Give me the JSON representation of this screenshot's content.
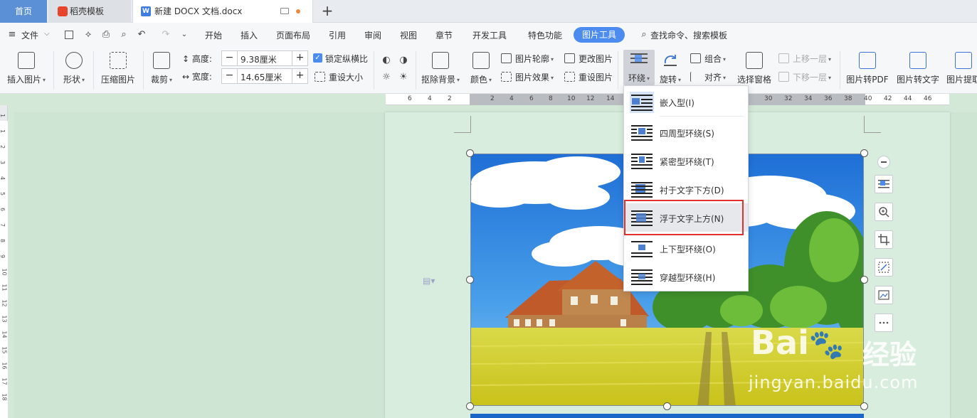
{
  "tabs": [
    {
      "label": "首页"
    },
    {
      "label": "稻壳模板"
    },
    {
      "label": "新建 DOCX 文档.docx"
    }
  ],
  "menu": {
    "file": "文件",
    "items": [
      "开始",
      "插入",
      "页面布局",
      "引用",
      "审阅",
      "视图",
      "章节",
      "开发工具",
      "特色功能"
    ],
    "active": "图片工具",
    "search": "查找命令、搜索模板"
  },
  "ribbon": {
    "insert_picture": "插入图片",
    "shape": "形状",
    "compress": "压缩图片",
    "crop": "裁剪",
    "height_label": "高度:",
    "height_value": "9.38厘米",
    "width_label": "宽度:",
    "width_value": "14.65厘米",
    "lock_ratio": "锁定纵横比",
    "reset_size": "重设大小",
    "remove_bg": "抠除背景",
    "color": "颜色",
    "outline": "图片轮廓",
    "effect": "图片效果",
    "change_picture": "更改图片",
    "reset_picture": "重设图片",
    "wrap": "环绕",
    "rotate": "旋转",
    "group": "组合",
    "align": "对齐",
    "select_pane": "选择窗格",
    "bring_forward": "上移一层",
    "send_backward": "下移一层",
    "to_pdf": "图片转PDF",
    "to_text": "图片转文字",
    "extract": "图片提取"
  },
  "ruler": {
    "h_numbers": [
      "6",
      "4",
      "2",
      "2",
      "4",
      "6",
      "8",
      "10",
      "12",
      "14",
      "30",
      "32",
      "34",
      "36",
      "38",
      "40",
      "42",
      "44",
      "46"
    ],
    "v_numbers": [
      "1",
      "1",
      "2",
      "3",
      "4",
      "5",
      "6",
      "7",
      "8",
      "9",
      "10",
      "11",
      "12",
      "13",
      "14",
      "15",
      "16",
      "17",
      "18"
    ]
  },
  "wrap_menu": [
    {
      "label": "嵌入型(I)"
    },
    {
      "label": "四周型环绕(S)"
    },
    {
      "label": "紧密型环绕(T)"
    },
    {
      "label": "衬于文字下方(D)"
    },
    {
      "label": "浮于文字上方(N)"
    },
    {
      "label": "上下型环绕(O)"
    },
    {
      "label": "穿越型环绕(H)"
    }
  ],
  "watermark": {
    "brand": "Bai",
    "brand_cn": "经验",
    "url": "jingyan.baidu.com"
  },
  "colors": {
    "accent": "#4c8cf0",
    "highlight_border": "#e03030",
    "doc_bg": "#d9edde"
  }
}
